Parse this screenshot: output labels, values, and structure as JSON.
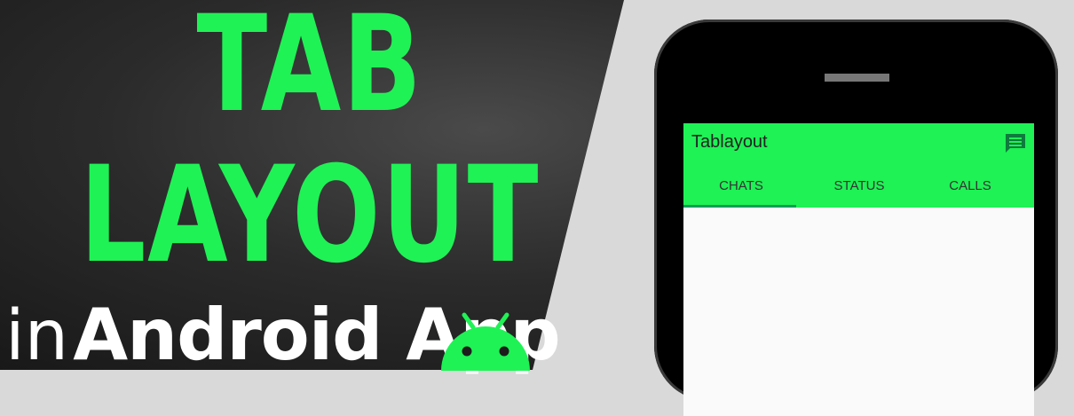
{
  "headline": {
    "line1": "TAB",
    "line2": "LAYOUT",
    "sub_prefix": "in",
    "sub_bold": "Android App",
    "accent_color": "#1ff255"
  },
  "icons": {
    "logo": "android-icon",
    "action": "chat-icon"
  },
  "app": {
    "title": "Tablayout",
    "tabs": [
      {
        "label": "CHATS",
        "selected": true
      },
      {
        "label": "STATUS",
        "selected": false
      },
      {
        "label": "CALLS",
        "selected": false
      }
    ],
    "toolbar_color": "#1ef255",
    "indicator_color": "#129b5a"
  }
}
